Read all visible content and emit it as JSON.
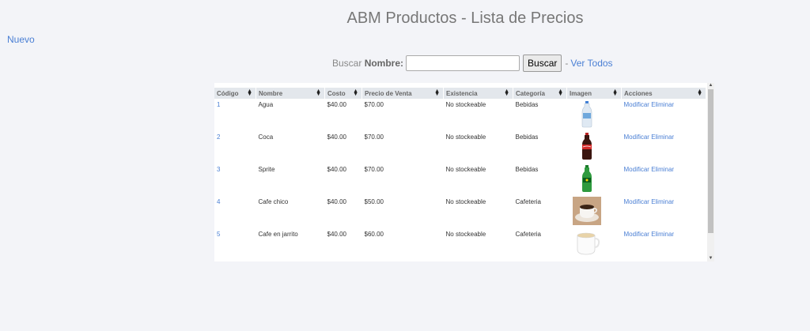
{
  "page": {
    "title": "ABM Productos - Lista de Precios",
    "nuevo_link": "Nuevo"
  },
  "search": {
    "label_prefix": "Buscar ",
    "label_bold": "Nombre:",
    "value": "",
    "button": "Buscar",
    "separator": "-",
    "ver_todos": "Ver Todos"
  },
  "table": {
    "headers": [
      "Código",
      "Nombre",
      "Costo",
      "Precio de Venta",
      "Existencia",
      "Categoría",
      "Imagen",
      "Acciones"
    ],
    "rows": [
      {
        "codigo": "1",
        "nombre": "Agua",
        "costo": "$40.00",
        "precio": "$70.00",
        "existencia": "No stockeable",
        "categoria": "Bebidas",
        "imagen": "water-bottle-image",
        "modificar": "Modificar",
        "eliminar": "Eliminar"
      },
      {
        "codigo": "2",
        "nombre": "Coca",
        "costo": "$40.00",
        "precio": "$70.00",
        "existencia": "No stockeable",
        "categoria": "Bebidas",
        "imagen": "coca-bottle-image",
        "modificar": "Modificar",
        "eliminar": "Eliminar"
      },
      {
        "codigo": "3",
        "nombre": "Sprite",
        "costo": "$40.00",
        "precio": "$70.00",
        "existencia": "No stockeable",
        "categoria": "Bebidas",
        "imagen": "sprite-bottle-image",
        "modificar": "Modificar",
        "eliminar": "Eliminar"
      },
      {
        "codigo": "4",
        "nombre": "Cafe chico",
        "costo": "$40.00",
        "precio": "$50.00",
        "existencia": "No stockeable",
        "categoria": "Cafeteria",
        "imagen": "coffee-cup-image",
        "modificar": "Modificar",
        "eliminar": "Eliminar"
      },
      {
        "codigo": "5",
        "nombre": "Cafe en jarrito",
        "costo": "$40.00",
        "precio": "$60.00",
        "existencia": "No stockeable",
        "categoria": "Cafeteria",
        "imagen": "coffee-mug-image",
        "modificar": "Modificar",
        "eliminar": "Eliminar"
      }
    ]
  },
  "icons": {
    "sort": "sort-icon",
    "scroll_up": "scroll-up-icon",
    "scroll_down": "scroll-down-icon"
  },
  "colors": {
    "link": "#4a7fd4",
    "header_bg": "#e3e7ec",
    "page_bg": "#f3f4f8"
  }
}
